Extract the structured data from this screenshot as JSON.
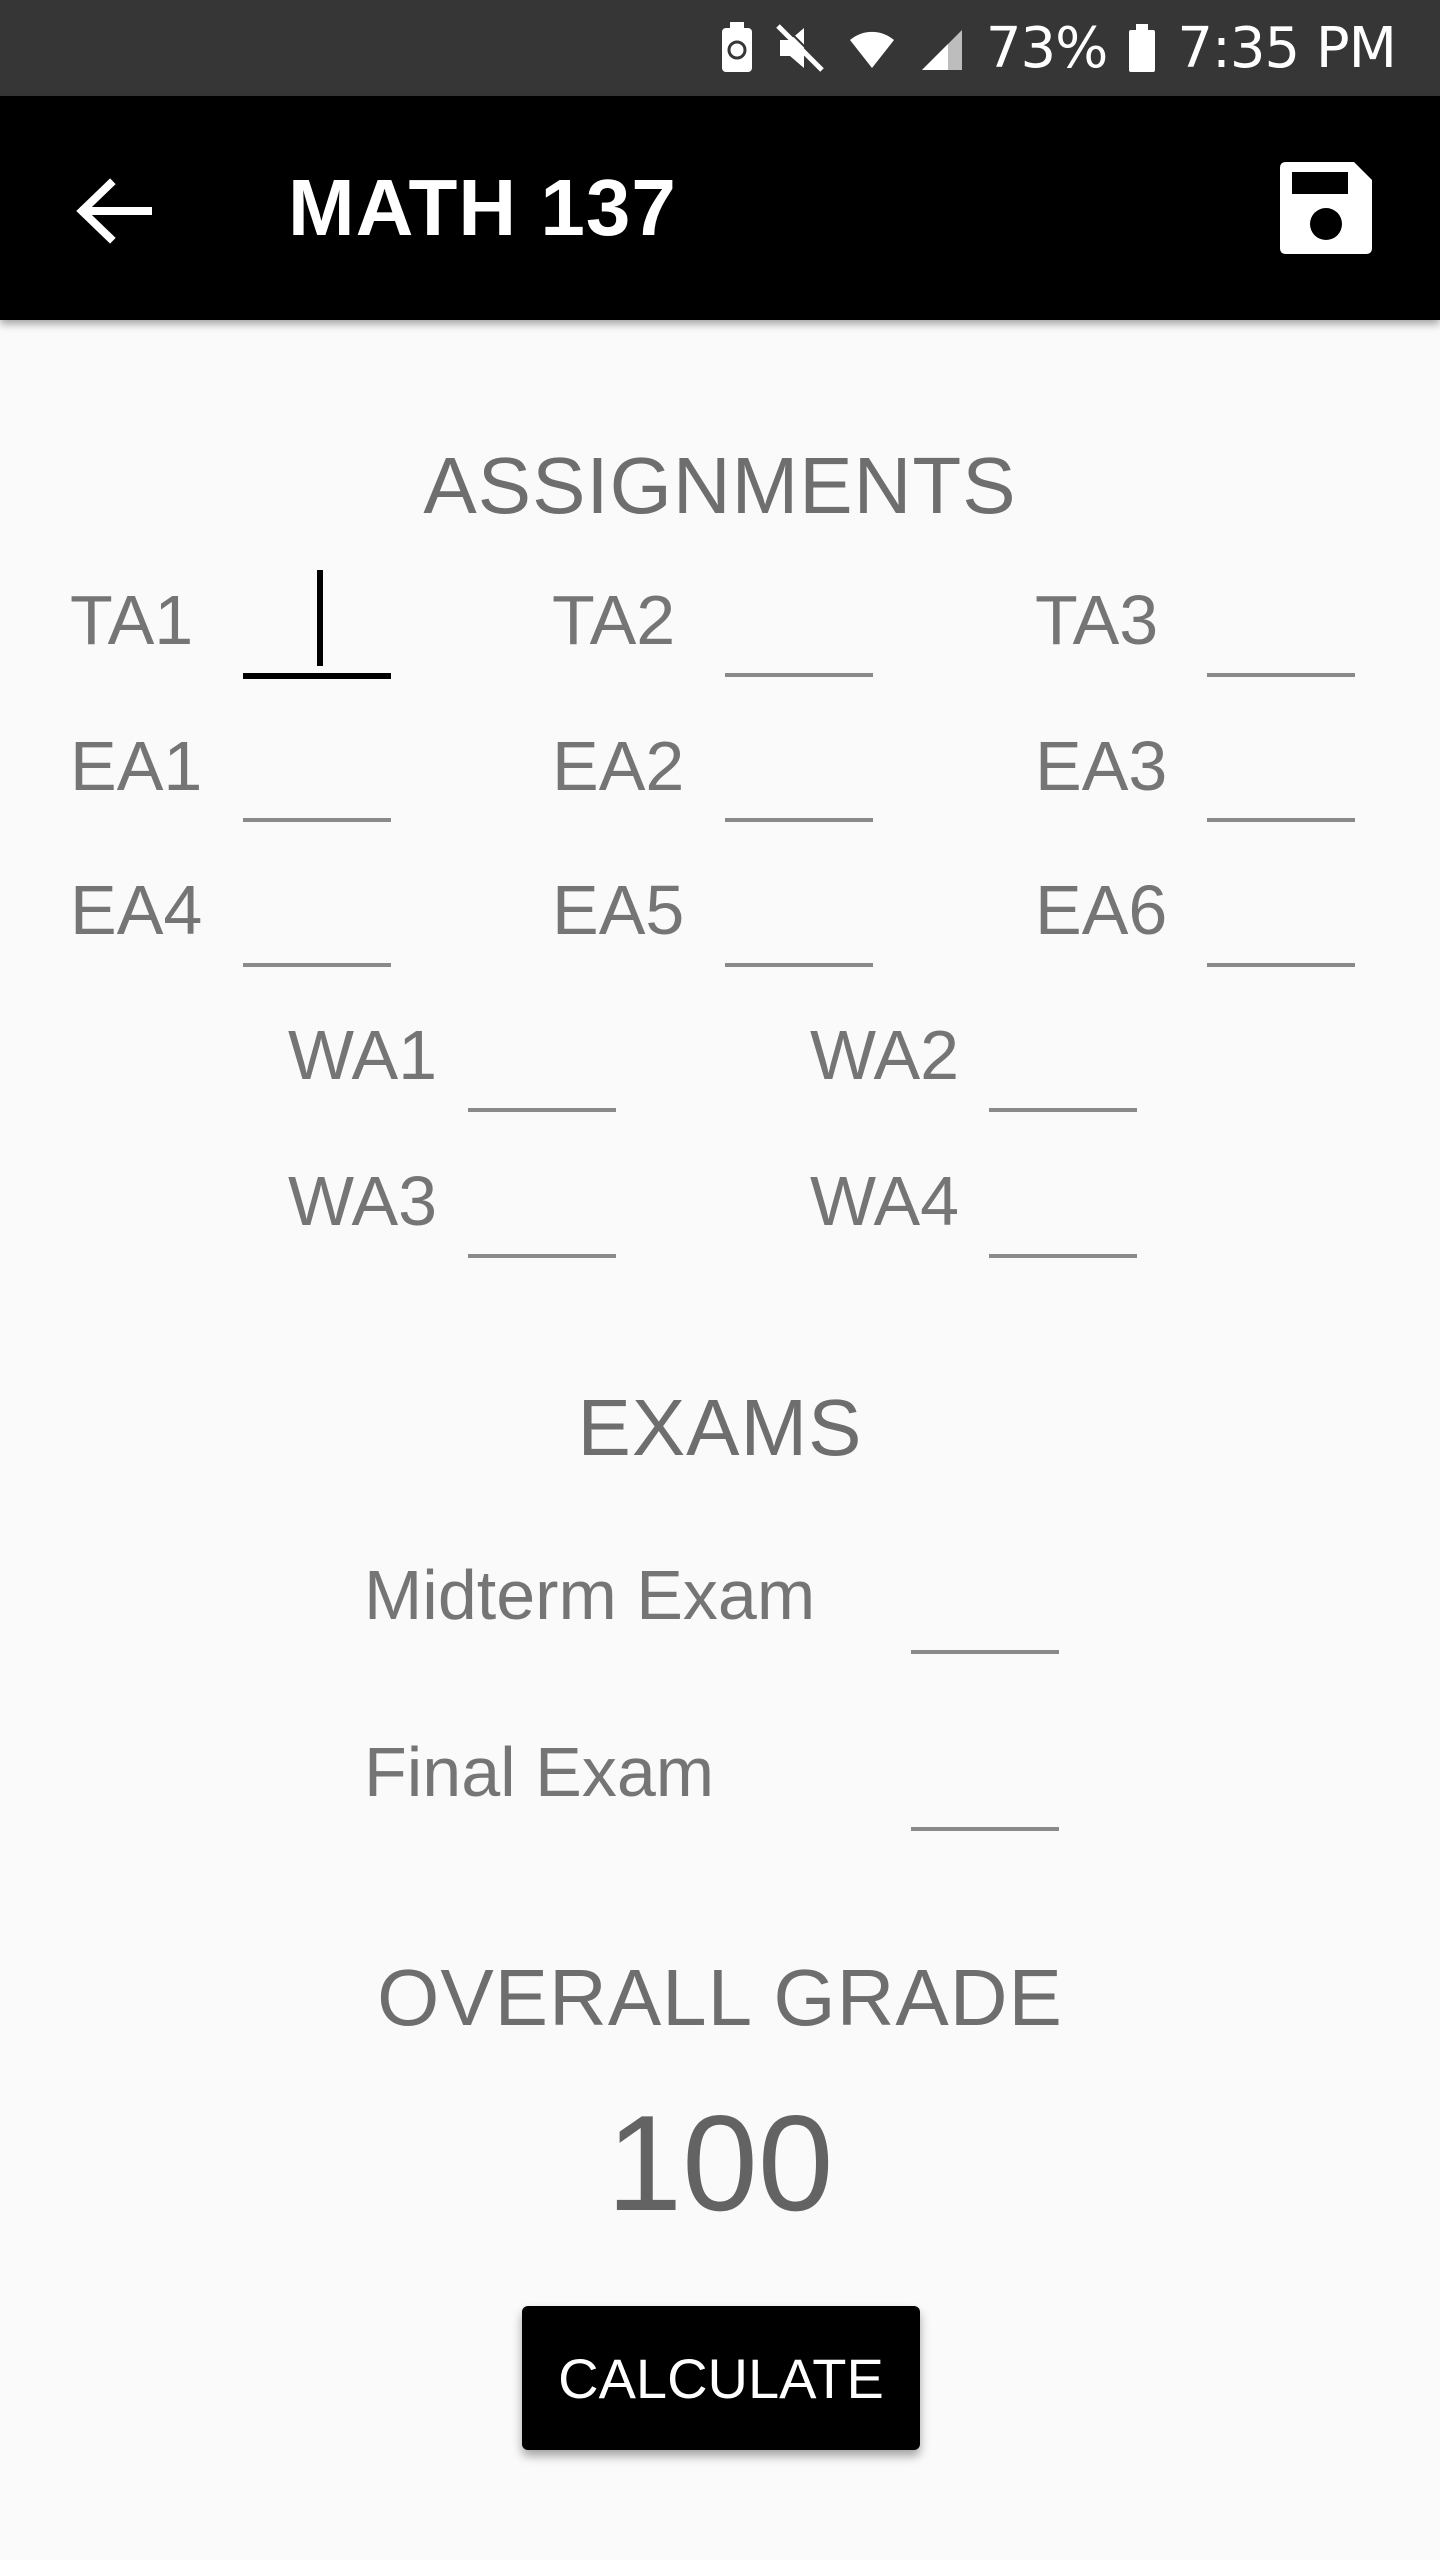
{
  "status_bar": {
    "battery_percent": "73%",
    "time": "7:35 PM",
    "icons": [
      "battery-saver-icon",
      "mute-icon",
      "wifi-icon",
      "signal-icon",
      "battery-icon"
    ]
  },
  "app_bar": {
    "title": "MATH 137",
    "back_icon": "arrow-back-icon",
    "save_icon": "floppy-save-icon"
  },
  "assignments": {
    "title": "ASSIGNMENTS",
    "fields": [
      {
        "label": "TA1",
        "value": ""
      },
      {
        "label": "TA2",
        "value": ""
      },
      {
        "label": "TA3",
        "value": ""
      },
      {
        "label": "EA1",
        "value": ""
      },
      {
        "label": "EA2",
        "value": ""
      },
      {
        "label": "EA3",
        "value": ""
      },
      {
        "label": "EA4",
        "value": ""
      },
      {
        "label": "EA5",
        "value": ""
      },
      {
        "label": "EA6",
        "value": ""
      },
      {
        "label": "WA1",
        "value": ""
      },
      {
        "label": "WA2",
        "value": ""
      },
      {
        "label": "WA3",
        "value": ""
      },
      {
        "label": "WA4",
        "value": ""
      }
    ]
  },
  "exams": {
    "title": "EXAMS",
    "fields": [
      {
        "label": "Midterm Exam",
        "value": ""
      },
      {
        "label": "Final Exam",
        "value": ""
      }
    ]
  },
  "overall": {
    "title": "OVERALL GRADE",
    "value": "100"
  },
  "calculate_label": "CALCULATE",
  "colors": {
    "status_bar": "#363636",
    "app_bar": "#000000",
    "background": "#fafafa",
    "label_text": "#757575",
    "heading_text": "#6e6e6e"
  }
}
